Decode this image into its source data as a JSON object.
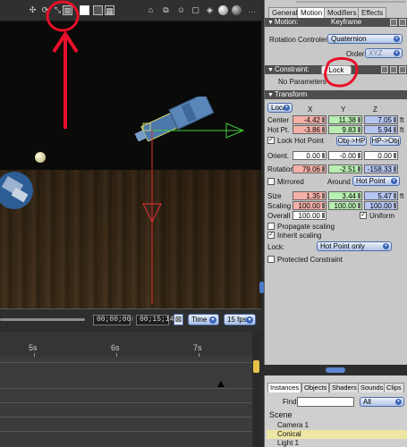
{
  "viewport": {
    "toolbar_icons": [
      "move-icon",
      "rotate-icon",
      "scale-icon",
      "lock-icon",
      "solid-view-icon",
      "wire-view-icon",
      "split-view-icon",
      "face-icon",
      "cube-icon",
      "texture-ball-icon",
      "shaded-ball-icon"
    ],
    "time_current": "00;00;00",
    "time_end": "00;15;14",
    "time_mode": "Time",
    "fps": "15 fps"
  },
  "timeline": {
    "ticks": [
      "5s",
      "6s",
      "7s"
    ]
  },
  "tabs": [
    "General",
    "Motion",
    "Modifiers",
    "Effects"
  ],
  "active_tab": "Motion",
  "motion": {
    "section": "Motion:",
    "keyframe_label": "Keyframe",
    "rotation_controller_label": "Rotation Controler",
    "rotation_controller_value": "Quaternion",
    "order_label": "Order",
    "order_value": "XYZ"
  },
  "constraint": {
    "section": "Constraint:",
    "value": "Lock",
    "no_params": "No Parameters"
  },
  "transform": {
    "section": "Transform",
    "space": "Local",
    "cols": [
      "X",
      "Y",
      "Z"
    ],
    "center_label": "Center",
    "center": [
      "-4.42",
      "11.38",
      "7.05"
    ],
    "center_unit": "ft",
    "hotpt_label": "Hot Pt.",
    "hotpt": [
      "-3.86",
      "9.83",
      "5.94"
    ],
    "hotpt_unit": "ft",
    "lock_hot_point": "Lock Hot Point",
    "obj_to_hp": "Obj->HP",
    "hp_to_obj": "HP->Obj",
    "orient_label": "Orient.",
    "orient": [
      "0.00",
      "-0.00",
      "0.00"
    ],
    "rotation_label": "Rotation",
    "rotation": [
      "79.06",
      "-2.51",
      "-158.33"
    ],
    "mirrored": "Mirrored",
    "around_label": "Around",
    "around_value": "Hot Point",
    "size_label": "Size",
    "size": [
      "1.35",
      "3.44",
      "5.47"
    ],
    "size_unit": "ft",
    "scaling_label": "Scaling",
    "scaling": [
      "100.00",
      "100.00",
      "100.00"
    ],
    "overall_label": "Overall",
    "overall": "100.00",
    "uniform": "Uniform",
    "propagate_scaling": "Propagate scaling",
    "inherit_scaling": "Inherit scaling",
    "lock_label": "Lock:",
    "lock_value": "Hot Point only",
    "protected_constraint": "Protected Constraint"
  },
  "lower": {
    "tabs": [
      "Instances",
      "Objects",
      "Shaders",
      "Sounds",
      "Clips"
    ],
    "active_tab": "Instances",
    "find_label": "Find:",
    "find_scope": "All",
    "scene_label": "Scene",
    "items": [
      "Camera 1",
      "Conical",
      "Light 1"
    ],
    "selected": "Conical"
  },
  "colors": {
    "annotation_red": "#e8102a",
    "axis_green": "#3fcf3f",
    "axis_red": "#e23030",
    "field_red": "#f4b0a8",
    "field_green": "#b9efb2",
    "field_blue": "#b6c6f3",
    "selected_row": "#eee6a4"
  }
}
